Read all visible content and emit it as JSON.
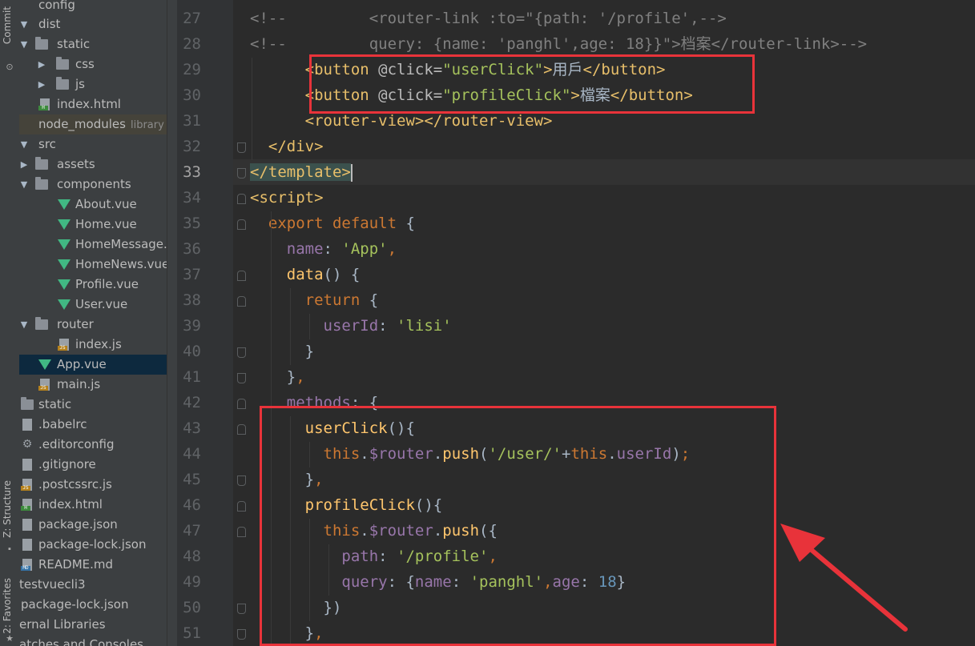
{
  "sidebar_tabs": {
    "commit": "Commit",
    "structure": "Z: Structure",
    "favorites": "2: Favorites"
  },
  "project_tree": [
    {
      "label": "config"
    },
    {
      "label": "dist"
    },
    {
      "label": "static"
    },
    {
      "label": "css"
    },
    {
      "label": "js"
    },
    {
      "label": "index.html"
    },
    {
      "label": "node_modules",
      "hint": "library roo"
    },
    {
      "label": "src"
    },
    {
      "label": "assets"
    },
    {
      "label": "components"
    },
    {
      "label": "About.vue"
    },
    {
      "label": "Home.vue"
    },
    {
      "label": "HomeMessage.vue"
    },
    {
      "label": "HomeNews.vue"
    },
    {
      "label": "Profile.vue"
    },
    {
      "label": "User.vue"
    },
    {
      "label": "router"
    },
    {
      "label": "index.js"
    },
    {
      "label": "App.vue"
    },
    {
      "label": "main.js"
    },
    {
      "label": "static"
    },
    {
      "label": ".babelrc"
    },
    {
      "label": ".editorconfig"
    },
    {
      "label": ".gitignore"
    },
    {
      "label": ".postcssrc.js"
    },
    {
      "label": "index.html"
    },
    {
      "label": "package.json"
    },
    {
      "label": "package-lock.json"
    },
    {
      "label": "README.md"
    },
    {
      "label": "testvuecli3"
    },
    {
      "label": "package-lock.json"
    },
    {
      "label": "ernal Libraries"
    },
    {
      "label": "atches and Consoles"
    }
  ],
  "editor": {
    "line_numbers": [
      "27",
      "28",
      "29",
      "30",
      "31",
      "32",
      "33",
      "34",
      "35",
      "36",
      "37",
      "38",
      "39",
      "40",
      "41",
      "42",
      "43",
      "44",
      "45",
      "46",
      "47",
      "48",
      "49",
      "50",
      "51"
    ],
    "current_line": "33",
    "lines": [
      [
        {
          "t": "<!--         <router-link :to=\"{path: '/profile',-->",
          "c": "comment"
        }
      ],
      [
        {
          "t": "<!--         query: {name: 'panghl',age: 18}}\">档案</router-link>-->",
          "c": "comment"
        }
      ],
      [
        {
          "t": "      ",
          "c": "plain"
        },
        {
          "t": "<button ",
          "c": "tag"
        },
        {
          "t": "@click=",
          "c": "attr"
        },
        {
          "t": "\"userClick\"",
          "c": "str"
        },
        {
          "t": ">",
          "c": "tag"
        },
        {
          "t": "用戶",
          "c": "plain"
        },
        {
          "t": "</button>",
          "c": "tag"
        }
      ],
      [
        {
          "t": "      ",
          "c": "plain"
        },
        {
          "t": "<button ",
          "c": "tag"
        },
        {
          "t": "@click=",
          "c": "attr"
        },
        {
          "t": "\"profileClick\"",
          "c": "str"
        },
        {
          "t": ">",
          "c": "tag"
        },
        {
          "t": "檔案",
          "c": "plain"
        },
        {
          "t": "</button>",
          "c": "tag"
        }
      ],
      [
        {
          "t": "      ",
          "c": "plain"
        },
        {
          "t": "<router-view></router-view>",
          "c": "tag"
        }
      ],
      [
        {
          "t": "  ",
          "c": "plain"
        },
        {
          "t": "</div>",
          "c": "tag"
        }
      ],
      [
        {
          "t": "</template>",
          "c": "tag-hl"
        },
        {
          "t": "",
          "c": "caret"
        }
      ],
      [
        {
          "t": "<script>",
          "c": "tag"
        }
      ],
      [
        {
          "t": "  ",
          "c": "plain"
        },
        {
          "t": "export default",
          "c": "kw"
        },
        {
          "t": " {",
          "c": "plain"
        }
      ],
      [
        {
          "t": "    ",
          "c": "plain"
        },
        {
          "t": "name",
          "c": "prop"
        },
        {
          "t": ": ",
          "c": "plain"
        },
        {
          "t": "'App'",
          "c": "str"
        },
        {
          "t": ",",
          "c": "kw"
        }
      ],
      [
        {
          "t": "    ",
          "c": "plain"
        },
        {
          "t": "data",
          "c": "fn"
        },
        {
          "t": "() {",
          "c": "plain"
        }
      ],
      [
        {
          "t": "      ",
          "c": "plain"
        },
        {
          "t": "return",
          "c": "kw"
        },
        {
          "t": " {",
          "c": "plain"
        }
      ],
      [
        {
          "t": "        ",
          "c": "plain"
        },
        {
          "t": "userId",
          "c": "prop"
        },
        {
          "t": ": ",
          "c": "plain"
        },
        {
          "t": "'lisi'",
          "c": "str"
        }
      ],
      [
        {
          "t": "      }",
          "c": "plain"
        }
      ],
      [
        {
          "t": "    }",
          "c": "plain"
        },
        {
          "t": ",",
          "c": "kw"
        }
      ],
      [
        {
          "t": "    ",
          "c": "plain"
        },
        {
          "t": "methods",
          "c": "prop"
        },
        {
          "t": ": {",
          "c": "plain"
        }
      ],
      [
        {
          "t": "      ",
          "c": "plain"
        },
        {
          "t": "userClick",
          "c": "fn"
        },
        {
          "t": "(){",
          "c": "plain"
        }
      ],
      [
        {
          "t": "        ",
          "c": "plain"
        },
        {
          "t": "this",
          "c": "kw"
        },
        {
          "t": ".",
          "c": "plain"
        },
        {
          "t": "$router",
          "c": "prop"
        },
        {
          "t": ".",
          "c": "plain"
        },
        {
          "t": "push",
          "c": "fn"
        },
        {
          "t": "(",
          "c": "plain"
        },
        {
          "t": "'/user/'",
          "c": "str"
        },
        {
          "t": "+",
          "c": "plain"
        },
        {
          "t": "this",
          "c": "kw"
        },
        {
          "t": ".",
          "c": "plain"
        },
        {
          "t": "userId",
          "c": "prop"
        },
        {
          "t": ")",
          "c": "plain"
        },
        {
          "t": ";",
          "c": "kw"
        }
      ],
      [
        {
          "t": "      }",
          "c": "plain"
        },
        {
          "t": ",",
          "c": "kw"
        }
      ],
      [
        {
          "t": "      ",
          "c": "plain"
        },
        {
          "t": "profileClick",
          "c": "fn"
        },
        {
          "t": "(){",
          "c": "plain"
        }
      ],
      [
        {
          "t": "        ",
          "c": "plain"
        },
        {
          "t": "this",
          "c": "kw"
        },
        {
          "t": ".",
          "c": "plain"
        },
        {
          "t": "$router",
          "c": "prop"
        },
        {
          "t": ".",
          "c": "plain"
        },
        {
          "t": "push",
          "c": "fn"
        },
        {
          "t": "({",
          "c": "plain"
        }
      ],
      [
        {
          "t": "          ",
          "c": "plain"
        },
        {
          "t": "path",
          "c": "prop"
        },
        {
          "t": ": ",
          "c": "plain"
        },
        {
          "t": "'/profile'",
          "c": "str"
        },
        {
          "t": ",",
          "c": "kw"
        }
      ],
      [
        {
          "t": "          ",
          "c": "plain"
        },
        {
          "t": "query",
          "c": "prop"
        },
        {
          "t": ": {",
          "c": "plain"
        },
        {
          "t": "name",
          "c": "prop"
        },
        {
          "t": ": ",
          "c": "plain"
        },
        {
          "t": "'panghl'",
          "c": "str"
        },
        {
          "t": ",",
          "c": "kw"
        },
        {
          "t": "age",
          "c": "prop"
        },
        {
          "t": ": ",
          "c": "plain"
        },
        {
          "t": "18",
          "c": "num"
        },
        {
          "t": "}",
          "c": "plain"
        }
      ],
      [
        {
          "t": "        })",
          "c": "plain"
        }
      ],
      [
        {
          "t": "      }",
          "c": "plain"
        },
        {
          "t": ",",
          "c": "kw"
        }
      ]
    ]
  },
  "colors": {
    "annotation": "#e8333a",
    "background": "#2b2b2b",
    "sidebar": "#3c3f41"
  }
}
